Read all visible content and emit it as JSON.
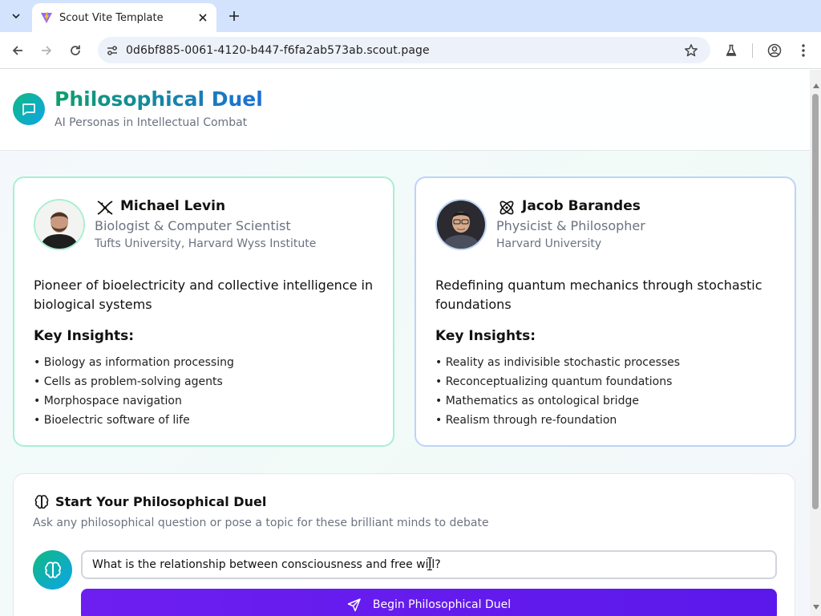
{
  "browser": {
    "tab_title": "Scout Vite Template",
    "url": "0d6bf885-0061-4120-b447-f6fa2ab573ab.scout.page"
  },
  "header": {
    "title": "Philosophical Duel",
    "subtitle": "AI Personas in Intellectual Combat"
  },
  "personas": [
    {
      "name": "Michael Levin",
      "role": "Biologist & Computer Scientist",
      "institution": "Tufts University, Harvard Wyss Institute",
      "description": "Pioneer of bioelectricity and collective intelligence in biological systems",
      "insights_heading": "Key Insights:",
      "insights": [
        "• Biology as information processing",
        "• Cells as problem-solving agents",
        "• Morphospace navigation",
        "• Bioelectric software of life"
      ],
      "icon": "dna-icon",
      "accent": "#a7f0d2"
    },
    {
      "name": "Jacob Barandes",
      "role": "Physicist & Philosopher",
      "institution": "Harvard University",
      "description": "Redefining quantum mechanics through stochastic foundations",
      "insights_heading": "Key Insights:",
      "insights": [
        "• Reality as indivisible stochastic processes",
        "• Reconceptualizing quantum foundations",
        "• Mathematics as ontological bridge",
        "• Realism through re-foundation"
      ],
      "icon": "atom-icon",
      "accent": "#bcd4f6"
    }
  ],
  "duel": {
    "title": "Start Your Philosophical Duel",
    "description": "Ask any philosophical question or pose a topic for these brilliant minds to debate",
    "question_value": "What is the relationship between consciousness and free will?",
    "button_label": "Begin Philosophical Duel"
  },
  "colors": {
    "brand_gradient_start": "#10b981",
    "brand_gradient_end": "#0ea5e9",
    "button": "#5b18ea"
  }
}
